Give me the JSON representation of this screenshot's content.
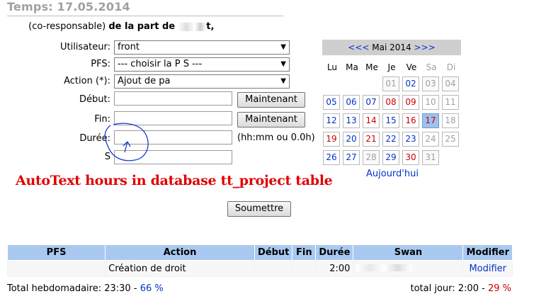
{
  "header": {
    "title": "Temps: 17.05.2014",
    "context_role": "(co-responsable)",
    "context_suffix": "de la part de",
    "context_name_tail": "t,"
  },
  "form": {
    "user_label": "Utilisateur:",
    "user_value": "front",
    "pfs_label": "PFS:",
    "pfs_value": "--- choisir la P S ---",
    "action_label": "Action (*):",
    "action_value": "Ajout de pa",
    "start_label": "Début:",
    "end_label": "Fin:",
    "duration_label": "Durée:",
    "swan_label": "S",
    "now_button": "Maintenant",
    "duration_hint": "(hh:mm ou 0.0h)",
    "submit_button": "Soumettre"
  },
  "calendar": {
    "prev": "<<<",
    "month": "Mai 2014",
    "next": ">>>",
    "weekdays": [
      "Lu",
      "Ma",
      "Me",
      "Je",
      "Ve",
      "Sa",
      "Di"
    ],
    "weeks": [
      [
        "",
        "",
        "",
        "01",
        "02",
        "03",
        "04"
      ],
      [
        "05",
        "06",
        "07",
        "08",
        "09",
        "10",
        "11"
      ],
      [
        "12",
        "13",
        "14",
        "15",
        "16",
        "17",
        "18"
      ],
      [
        "19",
        "20",
        "21",
        "22",
        "23",
        "24",
        "25"
      ],
      [
        "26",
        "27",
        "28",
        "29",
        "30",
        "31",
        ""
      ]
    ],
    "today_link": "Aujourd'hui"
  },
  "annotation": "AutoText hours in database tt_project table",
  "table": {
    "headers": [
      "PFS",
      "Action",
      "Début",
      "Fin",
      "Durée",
      "Swan",
      "Modifier"
    ],
    "rows": [
      {
        "pfs": "",
        "action": "Création de droit",
        "start": "",
        "end": "",
        "duration": "2:00",
        "swan": "",
        "modify": "Modifier"
      }
    ]
  },
  "totals": {
    "weekly_label": "Total hebdomadaire:",
    "weekly_value": "23:30",
    "weekly_sep": "-",
    "weekly_pct": "66 %",
    "day_label": "total jour:",
    "day_value": "2:00",
    "day_sep": "-",
    "day_pct": "29 %"
  },
  "colors": {
    "table_header": "#a9c9f0",
    "link": "#0033cc",
    "alert": "#cc0000",
    "today_cell": "#9cc2ef"
  }
}
